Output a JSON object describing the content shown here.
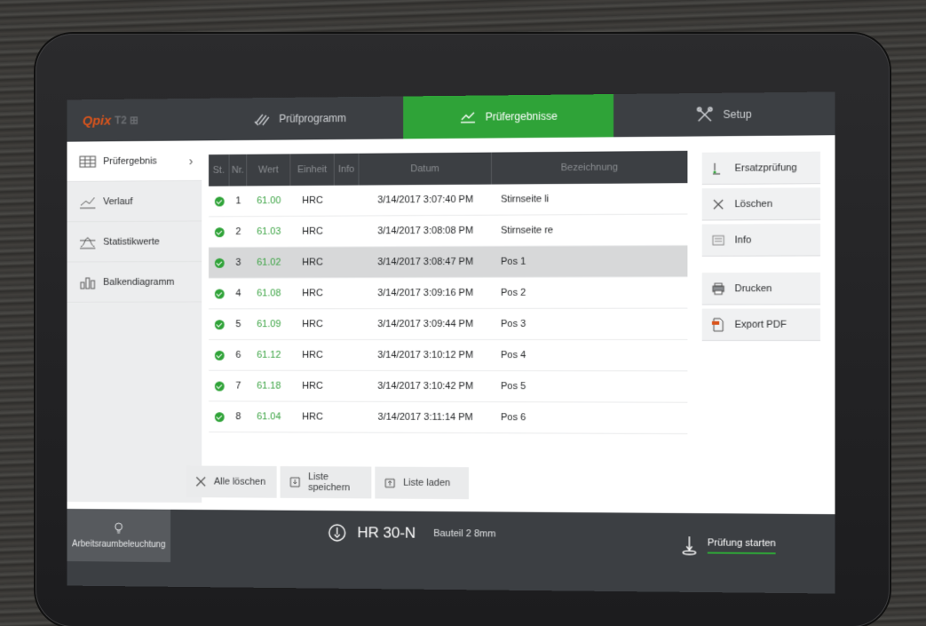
{
  "logo": {
    "brand": "Qpix",
    "rest": "T2 ⊞"
  },
  "top_tabs": [
    {
      "label": "Prüfprogramm"
    },
    {
      "label": "Prüfergebnisse"
    },
    {
      "label": "Setup"
    }
  ],
  "sidebar": {
    "items": [
      {
        "label": "Prüfergebnis"
      },
      {
        "label": "Verlauf"
      },
      {
        "label": "Statistikwerte"
      },
      {
        "label": "Balkendiagramm"
      }
    ]
  },
  "table": {
    "headers": [
      "St.",
      "Nr.",
      "Wert",
      "Einheit",
      "Info",
      "Datum",
      "Bezeichnung"
    ],
    "rows": [
      {
        "nr": "1",
        "wert": "61.00",
        "einheit": "HRC",
        "datum": "3/14/2017 3:07:40 PM",
        "bez": "Stirnseite li"
      },
      {
        "nr": "2",
        "wert": "61.03",
        "einheit": "HRC",
        "datum": "3/14/2017 3:08:08 PM",
        "bez": "Stirnseite re"
      },
      {
        "nr": "3",
        "wert": "61.02",
        "einheit": "HRC",
        "datum": "3/14/2017 3:08:47 PM",
        "bez": "Pos 1"
      },
      {
        "nr": "4",
        "wert": "61.08",
        "einheit": "HRC",
        "datum": "3/14/2017 3:09:16 PM",
        "bez": "Pos 2"
      },
      {
        "nr": "5",
        "wert": "61.09",
        "einheit": "HRC",
        "datum": "3/14/2017 3:09:44 PM",
        "bez": "Pos 3"
      },
      {
        "nr": "6",
        "wert": "61.12",
        "einheit": "HRC",
        "datum": "3/14/2017 3:10:12 PM",
        "bez": "Pos 4"
      },
      {
        "nr": "7",
        "wert": "61.18",
        "einheit": "HRC",
        "datum": "3/14/2017 3:10:42 PM",
        "bez": "Pos 5"
      },
      {
        "nr": "8",
        "wert": "61.04",
        "einheit": "HRC",
        "datum": "3/14/2017 3:11:14 PM",
        "bez": "Pos 6"
      }
    ],
    "selected_row": 3
  },
  "right_buttons": [
    {
      "label": "Ersatzprüfung",
      "icon": "replace-test-icon"
    },
    {
      "label": "Löschen",
      "icon": "close-icon"
    },
    {
      "label": "Info",
      "icon": "info-icon"
    },
    {
      "label": "Drucken",
      "icon": "printer-icon"
    },
    {
      "label": "Export PDF",
      "icon": "pdf-icon"
    }
  ],
  "bottom_buttons": [
    {
      "label": "Alle löschen"
    },
    {
      "label": "Liste speichern"
    },
    {
      "label": "Liste laden"
    }
  ],
  "status": {
    "lamp_label": "Arbeitsraumbeleuchtung",
    "method": "HR 30-N",
    "part": "Bauteil 2 8mm",
    "start_label": "Prüfung starten"
  },
  "colors": {
    "accent": "#2fa338",
    "bar": "#3c3f43",
    "logo": "#d9541c"
  }
}
